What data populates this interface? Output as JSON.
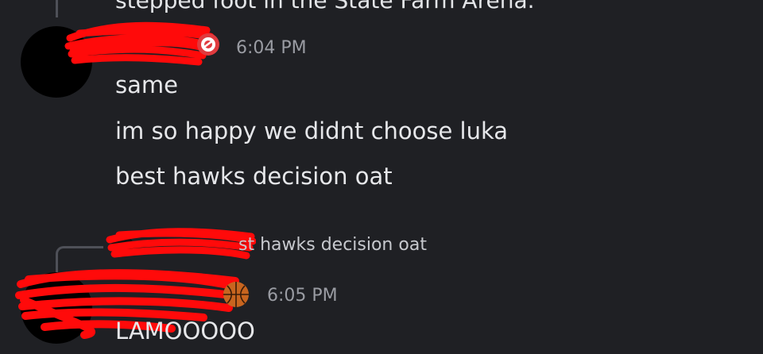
{
  "chat": {
    "previous_tail": "stepped foot in the State Farm Arena.",
    "groups": [
      {
        "timestamp": "6:04 PM",
        "messages": [
          "same",
          "im so happy we didnt choose luka",
          "best hawks decision oat"
        ],
        "role_icon": "hawks-logo-icon"
      },
      {
        "reply_preview": "st hawks decision oat",
        "timestamp": "6:05 PM",
        "messages": [
          "LAMOOOOO"
        ],
        "role_icon": "basketball-icon"
      }
    ]
  },
  "colors": {
    "background": "#1f2024",
    "text": "#e6e7ea",
    "muted": "#9a9ca3",
    "redaction": "#ff0a0a",
    "hawks_red": "#e03a3e"
  }
}
